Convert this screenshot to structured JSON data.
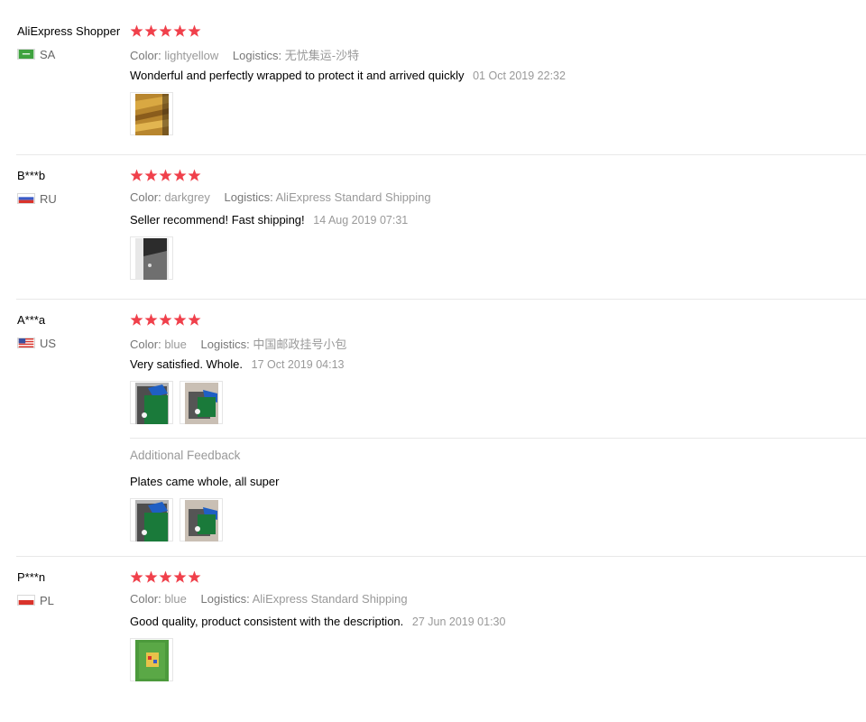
{
  "colors": {
    "star": "#f0404b",
    "label": "#777777",
    "muted": "#999999",
    "divider": "#e8e8e8"
  },
  "reviews": [
    {
      "name": "AliExpress Shopper",
      "country": "SA",
      "flag_icon": "saudi-arabia-flag-icon",
      "stars": 5,
      "color_label": "Color:",
      "color_value": "lightyellow",
      "logistics_label": "Logistics:",
      "logistics_value": "无忧集运-沙特",
      "text": "Wonderful and perfectly wrapped to protect it and arrived quickly",
      "date": "01 Oct 2019 22:32",
      "photos": [
        "gold-foil-photo"
      ]
    },
    {
      "name": "B***b",
      "country": "RU",
      "flag_icon": "russia-flag-icon",
      "stars": 5,
      "color_label": "Color:",
      "color_value": "darkgrey",
      "logistics_label": "Logistics:",
      "logistics_value": "AliExpress Standard Shipping",
      "text": "Seller recommend! Fast shipping!",
      "date": "14 Aug 2019 07:31",
      "photos": [
        "dark-grey-plate-photo"
      ]
    },
    {
      "name": "A***a",
      "country": "US",
      "flag_icon": "usa-flag-icon",
      "stars": 5,
      "color_label": "Color:",
      "color_value": "blue",
      "logistics_label": "Logistics:",
      "logistics_value": "中国邮政挂号小包",
      "text": "Very satisfied. Whole.",
      "date": "17 Oct 2019 04:13",
      "photos": [
        "blue-green-plates-photo",
        "blue-green-plates-photo"
      ],
      "additional": {
        "title": "Additional Feedback",
        "text": "Plates came whole, all super",
        "photos": [
          "blue-green-plates-photo",
          "blue-green-plates-photo"
        ]
      }
    },
    {
      "name": "P***n",
      "country": "PL",
      "flag_icon": "poland-flag-icon",
      "stars": 5,
      "color_label": "Color:",
      "color_value": "blue",
      "logistics_label": "Logistics:",
      "logistics_value": "AliExpress Standard Shipping",
      "text": "Good quality, product consistent with the description.",
      "date": "27 Jun 2019 01:30",
      "photos": [
        "green-mat-photo"
      ]
    }
  ]
}
